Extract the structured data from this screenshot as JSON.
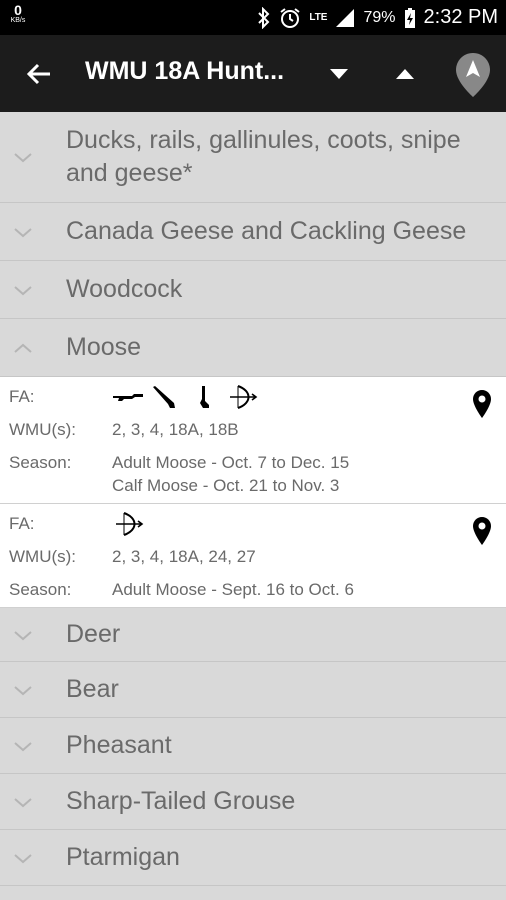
{
  "status_bar": {
    "kb_value": "0",
    "kb_unit": "KB/s",
    "network": "LTE",
    "battery": "79%",
    "time": "2:32 PM"
  },
  "app_bar": {
    "title": "WMU 18A Hunt..."
  },
  "categories_top": [
    {
      "label": "Ducks, rails, gallinules, coots, snipe and geese*",
      "expanded": false
    },
    {
      "label": "Canada Geese and Cackling Geese",
      "expanded": false
    },
    {
      "label": "Woodcock",
      "expanded": false
    },
    {
      "label": "Moose",
      "expanded": true
    }
  ],
  "moose_entries": [
    {
      "fa_label": "FA:",
      "fa_icons": [
        "rifle-icon",
        "shotgun-icon",
        "muzzleloader-icon",
        "bow-icon"
      ],
      "wmu_label": "WMU(s):",
      "wmu": "2, 3, 4, 18A, 18B",
      "season_label": "Season:",
      "season": [
        "Adult Moose - Oct. 7 to Dec. 15",
        "Calf Moose - Oct. 21 to Nov. 3"
      ]
    },
    {
      "fa_label": "FA:",
      "fa_icons": [
        "bow-icon"
      ],
      "wmu_label": "WMU(s):",
      "wmu": "2, 3, 4, 18A, 24, 27",
      "season_label": "Season:",
      "season": [
        "Adult Moose - Sept. 16 to Oct. 6"
      ]
    }
  ],
  "categories_bottom": [
    {
      "label": "Deer",
      "expanded": false
    },
    {
      "label": "Bear",
      "expanded": false
    },
    {
      "label": "Pheasant",
      "expanded": false
    },
    {
      "label": "Sharp-Tailed Grouse",
      "expanded": false
    },
    {
      "label": "Ptarmigan",
      "expanded": false
    }
  ]
}
